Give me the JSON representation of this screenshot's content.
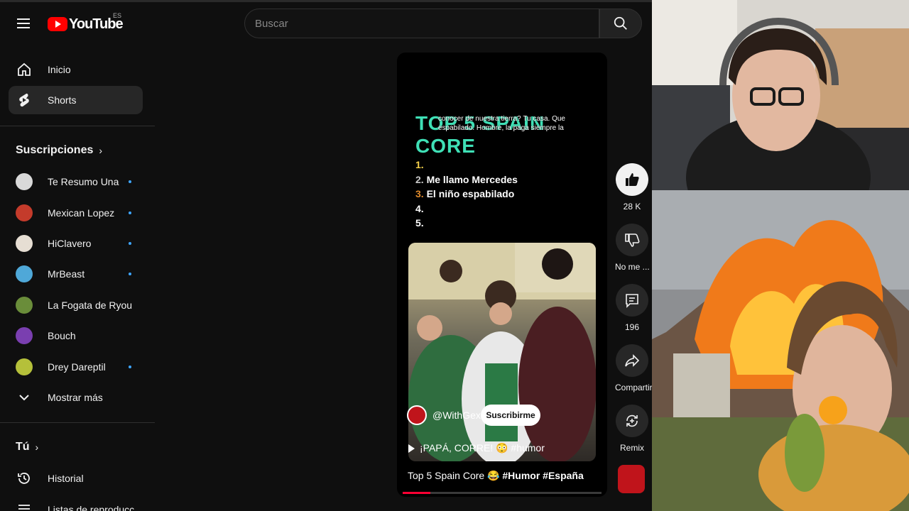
{
  "masthead": {
    "logo_text": "YouTube",
    "region": "ES",
    "search_placeholder": "Buscar"
  },
  "sidebar": {
    "nav": [
      {
        "label": "Inicio"
      },
      {
        "label": "Shorts"
      }
    ],
    "subscriptions_title": "Suscripciones",
    "subscriptions": [
      {
        "label": "Te Resumo Una",
        "new": true
      },
      {
        "label": "Mexican Lopez",
        "new": true
      },
      {
        "label": "HiClavero",
        "new": true
      },
      {
        "label": "MrBeast",
        "new": true
      },
      {
        "label": "La Fogata de Ryou ☾",
        "new": false
      },
      {
        "label": "Bouch",
        "new": false
      },
      {
        "label": "Drey Dareptil",
        "new": true
      }
    ],
    "show_more": "Mostrar más",
    "you_title": "Tú",
    "history": "Historial",
    "playlists": "Listas de reproducc"
  },
  "short": {
    "title_overlay": "TOP 5 SPAIN CORE",
    "caption": "conocer de nuestra tierra? Tu casa. Que espabilado. Hombre, la paga siempre la",
    "rank": [
      {
        "num": "1.",
        "text": ""
      },
      {
        "num": "2.",
        "text": "Me llamo Mercedes"
      },
      {
        "num": "3.",
        "text": "El niño espabilado"
      },
      {
        "num": "4.",
        "text": ""
      },
      {
        "num": "5.",
        "text": ""
      }
    ],
    "channel_handle": "@WithGex",
    "subscribe_label": "Suscribirme",
    "video_title": "¡PAPÁ, CORRE! 😳 #humor",
    "caption_plain": "Top 5 Spain Core 😂 ",
    "caption_tags": "#Humor #España",
    "progress": 0.14
  },
  "actions": {
    "like_count": "28 K",
    "dislike_label": "No me ...",
    "comments_count": "196",
    "share_label": "Compartir",
    "remix_label": "Remix"
  },
  "colors": {
    "accent_red": "#ff0000",
    "title_green": "#3fe0b6",
    "subscribed_dot": "#3ea6ff"
  }
}
